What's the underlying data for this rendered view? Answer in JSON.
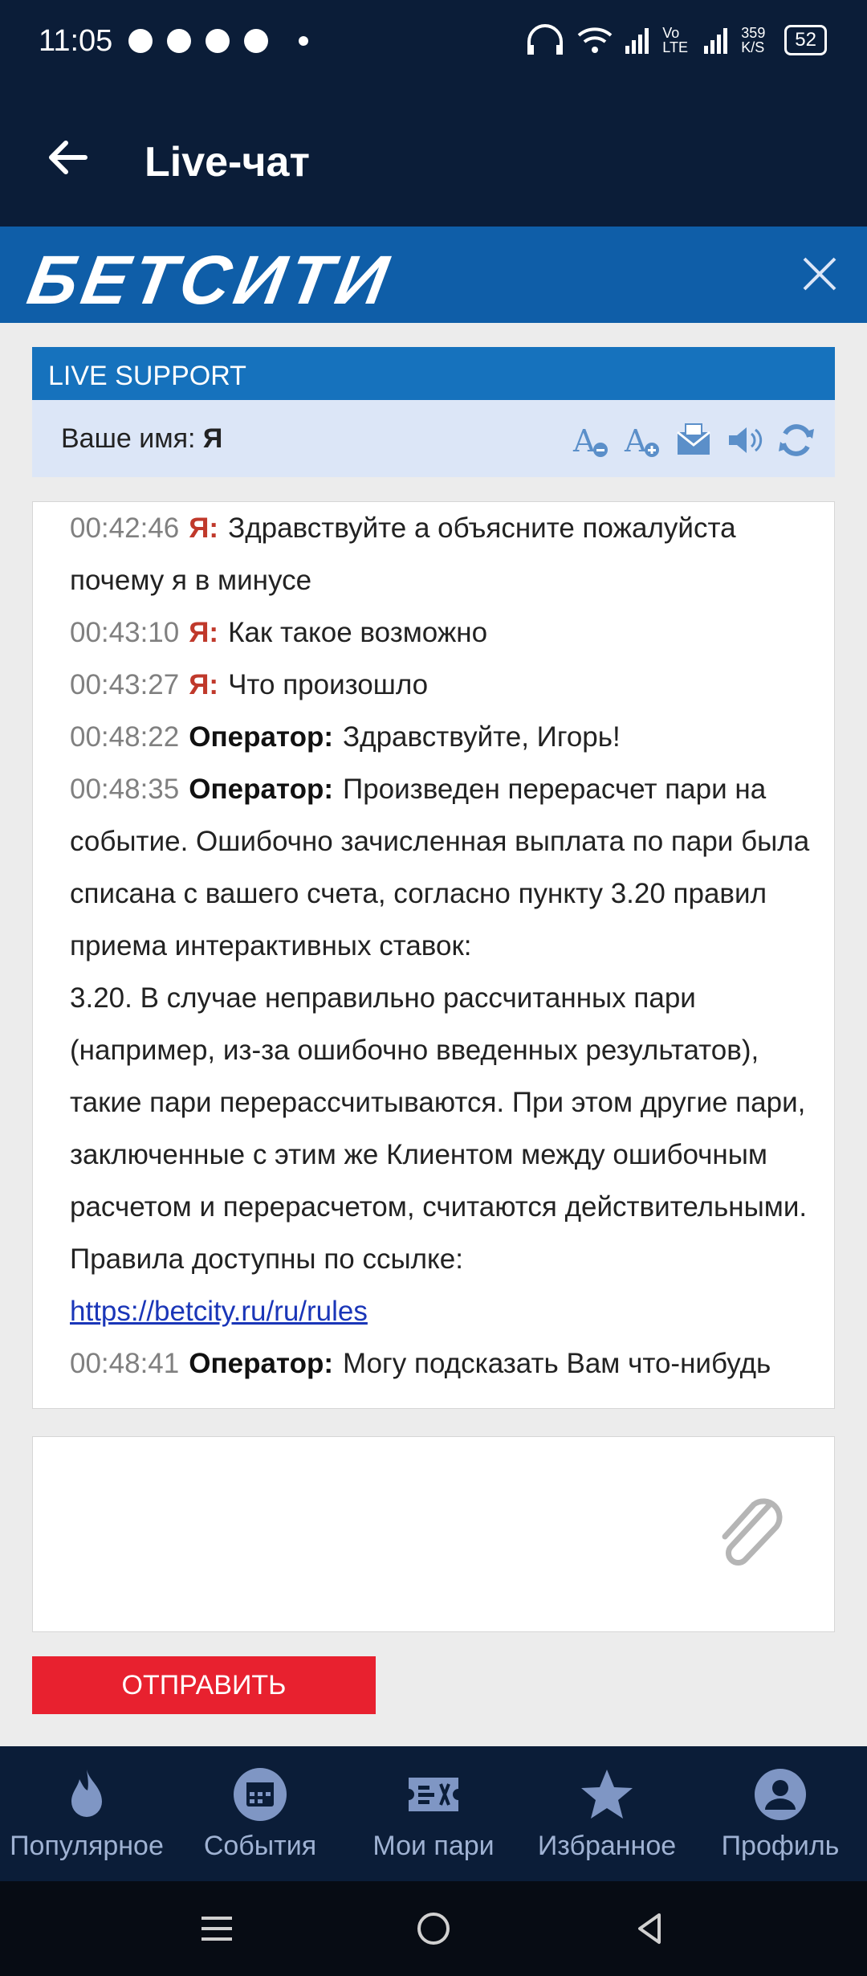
{
  "status_bar": {
    "time": "11:05",
    "network_speed": "359 K/S",
    "volte": "Vo LTE",
    "battery": "52"
  },
  "app_bar": {
    "title": "Live-чат"
  },
  "brand": {
    "logo_text": "БЕТСИТИ"
  },
  "support": {
    "header": "LIVE SUPPORT",
    "name_label": "Ваше имя:",
    "name_value": "Я",
    "tools": [
      "font-decrease-icon",
      "font-increase-icon",
      "email-icon",
      "sound-icon",
      "refresh-icon"
    ]
  },
  "chat": {
    "messages": [
      {
        "time": "00:42:46",
        "author": "Я:",
        "text": "Здравствуйте а объясните пожалуйста почему я в минусе"
      },
      {
        "time": "00:43:10",
        "author": "Я:",
        "text": "Как такое возможно"
      },
      {
        "time": "00:43:27",
        "author": "Я:",
        "text": "Что произошло"
      },
      {
        "time": "00:48:22",
        "author": "Оператор:",
        "text": "Здравствуйте, Игорь!"
      },
      {
        "time": "00:48:35",
        "author": "Оператор:",
        "text": "Произведен перерасчет пари на событие. Ошибочно зачисленная выплата по пари была списана с вашего счета, согласно пункту 3.20 правил приема интерактивных ставок:",
        "text2": "3.20. В случае неправильно рассчитанных пари (например, из-за ошибочно введенных результатов), такие пари перерассчитываются. При этом другие пари, заключенные с этим же Клиентом между ошибочным расчетом и перерасчетом, считаются действительными.",
        "text3": "Правила доступны по ссылке:",
        "link": "https://betcity.ru/ru/rules"
      },
      {
        "time": "00:48:41",
        "author": "Оператор:",
        "text": "Могу подсказать Вам что-нибудь"
      }
    ]
  },
  "composer": {
    "send_label": "ОТПРАВИТЬ"
  },
  "bottom_nav": {
    "items": [
      {
        "label": "Популярное",
        "icon": "flame-icon"
      },
      {
        "label": "События",
        "icon": "calendar-icon"
      },
      {
        "label": "Мои пари",
        "icon": "ticket-icon"
      },
      {
        "label": "Избранное",
        "icon": "star-icon"
      },
      {
        "label": "Профиль",
        "icon": "profile-icon"
      }
    ]
  },
  "colors": {
    "brand_blue": "#0f5ea8",
    "dark_navy": "#0b1d38",
    "send_red": "#e8212f",
    "me_red": "#c0392b"
  }
}
